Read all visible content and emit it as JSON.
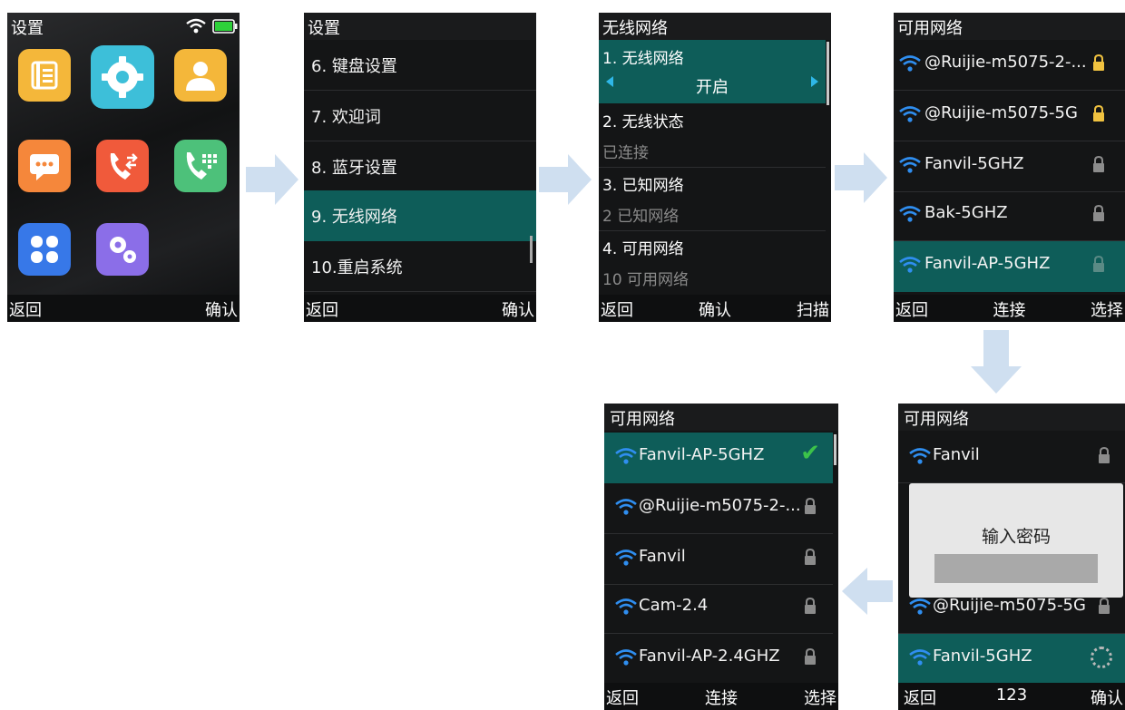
{
  "screen1": {
    "title": "设置",
    "softkeys": {
      "left": "返回",
      "right": "确认"
    },
    "apps": [
      {
        "name": "contacts-list-icon",
        "color": "#f4b73a"
      },
      {
        "name": "settings-gear-icon",
        "color": "#3dbfd9"
      },
      {
        "name": "contact-person-icon",
        "color": "#f4b73a"
      },
      {
        "name": "messages-icon",
        "color": "#f5873b"
      },
      {
        "name": "call-history-icon",
        "color": "#f05a3b"
      },
      {
        "name": "dialpad-icon",
        "color": "#4dc17a"
      },
      {
        "name": "apps-grid-icon",
        "color": "#3778e8"
      },
      {
        "name": "advanced-settings-icon",
        "color": "#8b6ee8"
      }
    ]
  },
  "screen2": {
    "title": "设置",
    "items": [
      "6. 键盘设置",
      "7. 欢迎词",
      "8. 蓝牙设置",
      "9. 无线网络",
      "10.重启系统"
    ],
    "selected_index": 3,
    "softkeys": {
      "left": "返回",
      "right": "确认"
    }
  },
  "screen3": {
    "title": "无线网络",
    "items": [
      {
        "label": "1. 无线网络",
        "value": "开启"
      },
      {
        "label": "2. 无线状态",
        "value": "已连接"
      },
      {
        "label": "3. 已知网络",
        "value": "2 已知网络"
      },
      {
        "label": "4. 可用网络",
        "value": "10 可用网络"
      }
    ],
    "softkeys": {
      "left": "返回",
      "center": "确认",
      "right": "扫描"
    }
  },
  "screen4": {
    "title": "可用网络",
    "networks": [
      "@Ruijie-m5075-2-...",
      "@Ruijie-m5075-5G",
      "Fanvil-5GHZ",
      "Bak-5GHZ",
      "Fanvil-AP-5GHZ"
    ],
    "selected_index": 4,
    "softkeys": {
      "left": "返回",
      "center": "连接",
      "right": "选择"
    }
  },
  "screen5": {
    "title": "可用网络",
    "networks": [
      "Fanvil",
      "@Ruijie-m5075-5G",
      "Fanvil-5GHZ"
    ],
    "dialog": {
      "title": "输入密码",
      "input_value": ""
    },
    "softkeys": {
      "left": "返回",
      "center": "123",
      "right": "确认"
    }
  },
  "screen6": {
    "title": "可用网络",
    "networks": [
      "Fanvil-AP-5GHZ",
      "@Ruijie-m5075-2-...",
      "Fanvil",
      "Cam-2.4",
      "Fanvil-AP-2.4GHZ"
    ],
    "connected_index": 0,
    "softkeys": {
      "left": "返回",
      "center": "连接",
      "right": "选择"
    }
  },
  "colors": {
    "accent": "#0e5d59",
    "wifi": "#2f8ef0",
    "arrow": "#cfdff0",
    "lock": "#8c8c8c"
  }
}
